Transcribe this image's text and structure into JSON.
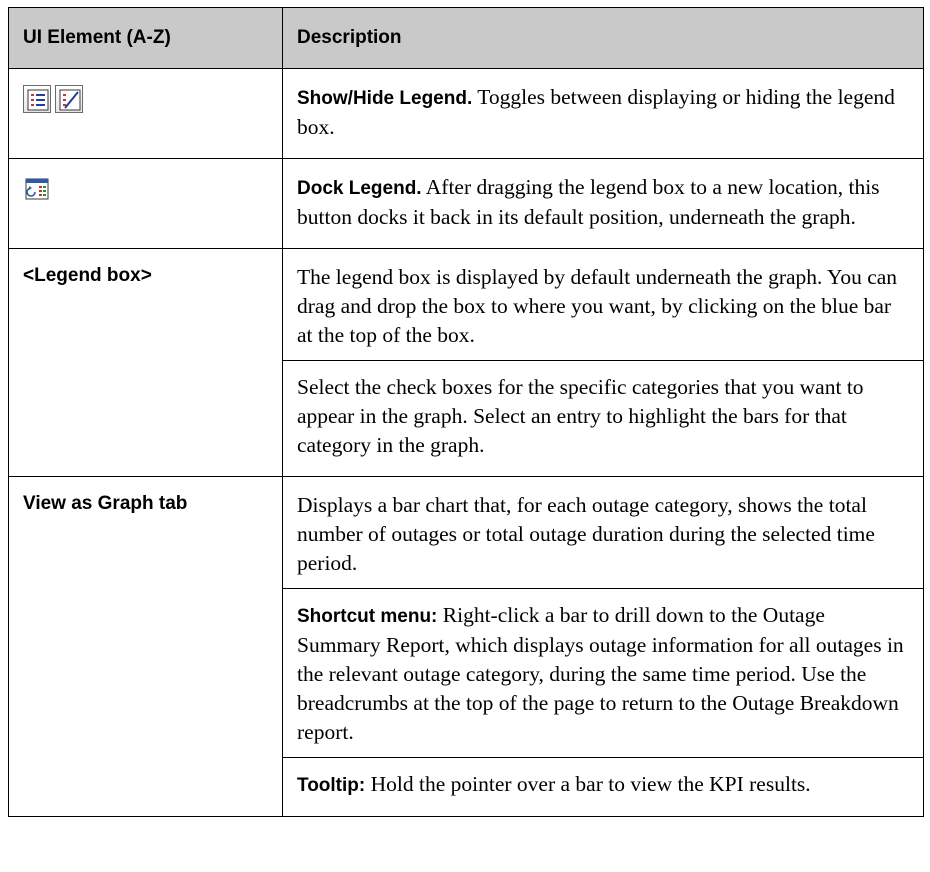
{
  "table": {
    "header": {
      "col1": "UI Element (A-Z)",
      "col2": "Description"
    },
    "rows": [
      {
        "icons": [
          "show-legend-icon",
          "hide-legend-icon"
        ],
        "paragraphs": [
          {
            "lead": "Show/Hide Legend.",
            "text": " Toggles between displaying or hiding the legend box."
          }
        ]
      },
      {
        "icons": [
          "dock-legend-icon"
        ],
        "paragraphs": [
          {
            "lead": "Dock Legend.",
            "text": " After dragging the legend box to a new location, this button docks it back in its default position, underneath the graph."
          }
        ]
      },
      {
        "name": "<Legend box>",
        "paragraphs": [
          {
            "lead": "",
            "text": "The legend box is displayed by default underneath the graph. You can drag and drop the box to where you want, by clicking on the blue bar at the top of the box."
          },
          {
            "lead": "",
            "text": "Select the check boxes for the specific categories that you want to appear in the graph. Select an entry to highlight the bars for that category in the graph."
          }
        ]
      },
      {
        "name": "View as Graph tab",
        "paragraphs": [
          {
            "lead": "",
            "text": "Displays a bar chart that, for each outage category, shows the total number of outages or total outage duration during the selected time period."
          },
          {
            "lead": "Shortcut menu:",
            "text": " Right-click a bar to drill down to the Outage Summary Report, which displays outage information for all outages in the relevant outage category, during the same time period. Use the breadcrumbs at the top of the page to return to the Outage Breakdown report."
          },
          {
            "lead": "Tooltip:",
            "text": " Hold the pointer over a bar to view the KPI results."
          }
        ]
      }
    ]
  }
}
